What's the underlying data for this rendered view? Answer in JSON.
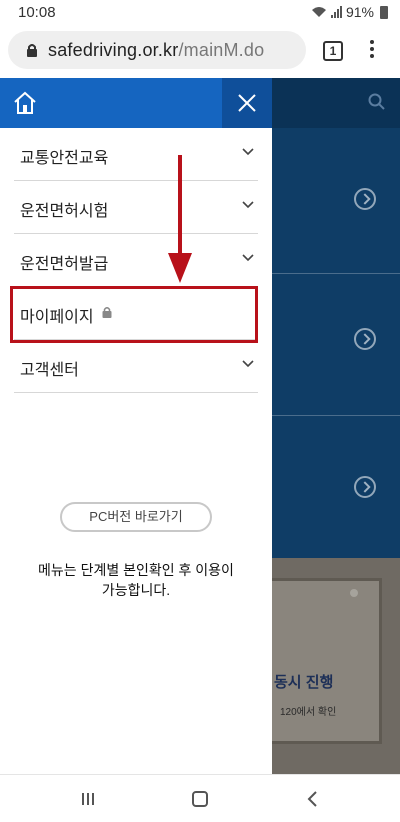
{
  "status_bar": {
    "time": "10:08",
    "battery": "91%"
  },
  "browser": {
    "url_domain": "safedriving.or.kr",
    "url_path": "/mainM.do",
    "tab_count": "1"
  },
  "side_menu": {
    "items": [
      {
        "label": "교통안전교육",
        "icon": "chevron-down-icon"
      },
      {
        "label": "운전면허시험",
        "icon": "chevron-down-icon"
      },
      {
        "label": "운전면허발급",
        "icon": "chevron-down-icon"
      },
      {
        "label": "마이페이지",
        "icon": "lock-icon"
      },
      {
        "label": "고객센터",
        "icon": "chevron-down-icon"
      }
    ],
    "pc_button": "PC버전 바로가기",
    "notice_line1": "메뉴는 단계별 본인확인 후 이용이",
    "notice_line2": "가능합니다."
  },
  "background_page": {
    "banner_title": "동시 진행",
    "banner_sub": "120에서 확인"
  },
  "colors": {
    "menu_header": "#1565c0",
    "highlight": "#b8111a",
    "page_bg": "#0f3d66"
  }
}
